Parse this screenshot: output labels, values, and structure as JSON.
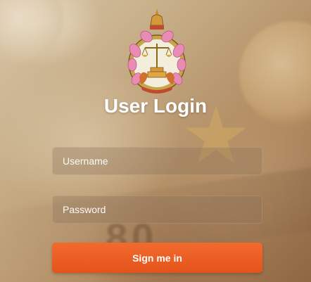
{
  "login": {
    "title": "User Login",
    "username_placeholder": "Username",
    "password_placeholder": "Password",
    "signin_label": "Sign me in"
  },
  "icons": {
    "emblem": "government-emblem-icon"
  },
  "colors": {
    "button": "#ef5f24",
    "title": "#ffffff"
  }
}
